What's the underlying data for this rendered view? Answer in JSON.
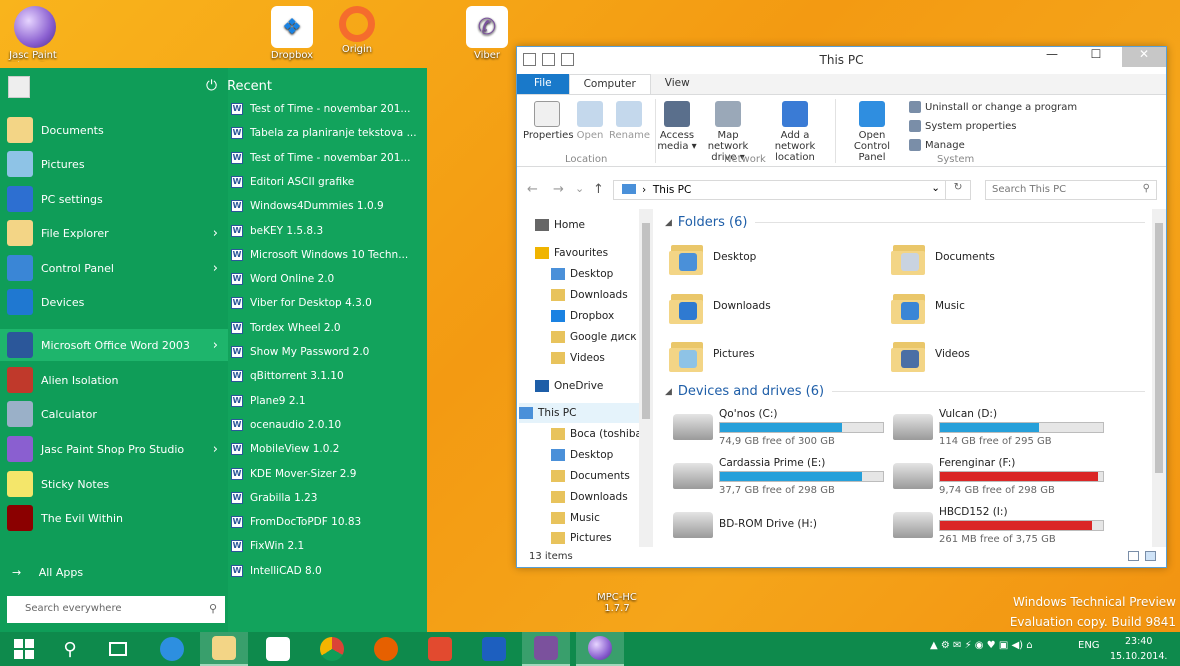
{
  "desktop": {
    "icons": [
      {
        "label": "Jasc Paint Shop Pro",
        "icon": "jasc-orb-icon"
      },
      {
        "label": "Dropbox",
        "icon": "dropbox-icon"
      },
      {
        "label": "Origin",
        "icon": "origin-icon"
      },
      {
        "label": "Viber",
        "icon": "viber-icon"
      },
      {
        "label": "MPC-HC",
        "icon": "mpc-hc-icon"
      }
    ],
    "mpc_sub": "1.7.7",
    "watermark_line1": "Windows Technical Preview",
    "watermark_line2": "Evaluation copy. Build 9841"
  },
  "start_menu": {
    "accent": "#0f9d58",
    "pinned": [
      {
        "label": "Documents",
        "icon": "documents-icon"
      },
      {
        "label": "Pictures",
        "icon": "pictures-icon"
      },
      {
        "label": "PC settings",
        "icon": "gear-icon"
      },
      {
        "label": "File Explorer",
        "icon": "file-explorer-icon",
        "arrow": "›"
      },
      {
        "label": "Control Panel",
        "icon": "control-panel-icon",
        "arrow": "›"
      },
      {
        "label": "Devices",
        "icon": "devices-gear-icon"
      },
      {
        "label": "Microsoft Office Word 2003",
        "icon": "word-icon",
        "arrow": "›"
      },
      {
        "label": "Alien Isolation",
        "icon": "alien-isolation-icon"
      },
      {
        "label": "Calculator",
        "icon": "calculator-icon"
      },
      {
        "label": "Jasc Paint Shop Pro Studio",
        "icon": "jasc-orb-icon",
        "arrow": "›"
      },
      {
        "label": "Sticky Notes",
        "icon": "sticky-notes-icon"
      },
      {
        "label": "The Evil Within",
        "icon": "evil-within-icon"
      }
    ],
    "recent_title": "Recent",
    "power_glyph": "⏻",
    "recent": [
      "Test of Time - novembar 201...",
      "Tabela za planiranje tekstova ...",
      "Test of Time - novembar 201...",
      "Editori ASCII grafike",
      "Windows4Dummies 1.0.9",
      "beKEY 1.5.8.3",
      "Microsoft Windows 10 Techn...",
      "Word Online 2.0",
      "Viber for Desktop 4.3.0",
      "Tordex Wheel 2.0",
      "Show My Password 2.0",
      "qBittorrent 3.1.10",
      "Plane9 2.1",
      "ocenaudio 2.0.10",
      "MobileView 1.0.2",
      "KDE Mover-Sizer 2.9",
      "Grabilla 1.23",
      "FromDocToPDF 10.83",
      "FixWin 2.1",
      "IntelliCAD 8.0"
    ],
    "word_glyph": "W",
    "all_apps_arrow": "→",
    "all_apps": "All Apps",
    "search_placeholder": "Search everywhere",
    "search_glyph": "⚲"
  },
  "explorer": {
    "title": "This PC",
    "minimize": "—",
    "maximize": "☐",
    "close": "✕",
    "tabs": [
      "File",
      "Computer",
      "View"
    ],
    "ribbon": {
      "location": {
        "group": "Location",
        "buttons": [
          "Properties",
          "Open",
          "Rename"
        ]
      },
      "network": {
        "group": "Network",
        "buttons": [
          "Access media ▾",
          "Map network drive ▾",
          "Add a network location"
        ]
      },
      "system": {
        "group": "System",
        "open_cp": "Open Control Panel",
        "small": [
          "Uninstall or change a program",
          "System properties",
          "Manage"
        ]
      }
    },
    "nav_glyphs": {
      "back": "←",
      "forward": "→",
      "dropdown": "⌄",
      "up": "↑",
      "chev": "›",
      "refresh": "↻"
    },
    "address": "This PC",
    "search_placeholder": "Search This PC",
    "nav_pane": [
      {
        "label": "Home",
        "icon": "home-icon"
      },
      {
        "label": "Favourites",
        "icon": "star-icon"
      },
      {
        "label": "Desktop",
        "icon": "desktop-icon"
      },
      {
        "label": "Downloads",
        "icon": "downloads-icon"
      },
      {
        "label": "Dropbox",
        "icon": "dropbox-icon"
      },
      {
        "label": "Google диск",
        "icon": "google-drive-icon"
      },
      {
        "label": "Videos",
        "icon": "videos-icon"
      },
      {
        "label": "OneDrive",
        "icon": "onedrive-icon"
      },
      {
        "label": "This PC",
        "icon": "pc-icon"
      },
      {
        "label": "Boca (toshiba-",
        "icon": "user-folder-icon"
      },
      {
        "label": "Desktop",
        "icon": "desktop-icon"
      },
      {
        "label": "Documents",
        "icon": "documents-icon"
      },
      {
        "label": "Downloads",
        "icon": "downloads-icon"
      },
      {
        "label": "Music",
        "icon": "music-icon"
      },
      {
        "label": "Pictures",
        "icon": "pictures-icon"
      }
    ],
    "folders_header": "Folders (6)",
    "folders": [
      {
        "label": "Desktop",
        "badge": "#4a90d9"
      },
      {
        "label": "Documents",
        "badge": "#c9d3e0"
      },
      {
        "label": "Downloads",
        "badge": "#2f7ad1"
      },
      {
        "label": "Music",
        "badge": "#3a86d6"
      },
      {
        "label": "Pictures",
        "badge": "#8ec3e6"
      },
      {
        "label": "Videos",
        "badge": "#4a6fa5"
      }
    ],
    "drives_header": "Devices and drives (6)",
    "drives": [
      {
        "name": "Qo'nos (C:)",
        "free": "74,9 GB free of 300 GB",
        "used_fraction": 0.75,
        "color": "#26a0da"
      },
      {
        "name": "Vulcan (D:)",
        "free": "114 GB free of 295 GB",
        "used_fraction": 0.61,
        "color": "#26a0da"
      },
      {
        "name": "Cardassia Prime (E:)",
        "free": "37,7 GB free of 298 GB",
        "used_fraction": 0.87,
        "color": "#26a0da"
      },
      {
        "name": "Ferenginar (F:)",
        "free": "9,74 GB free of 298 GB",
        "used_fraction": 0.97,
        "color": "#da2626"
      },
      {
        "name": "BD-ROM Drive (H:)",
        "free": "",
        "used_fraction": null,
        "color": ""
      },
      {
        "name": "HBCD152 (I:)",
        "free": "261 MB free of 3,75 GB",
        "used_fraction": 0.93,
        "color": "#da2626"
      }
    ],
    "status": "13 items"
  },
  "taskbar": {
    "color": "#0e8a4c",
    "tray_icons": "▲ ⚙ ✉ ⚡ ◉ ♥ ▣ ◀) ⌂",
    "language": "ENG",
    "time": "23:40",
    "date": "15.10.2014."
  }
}
